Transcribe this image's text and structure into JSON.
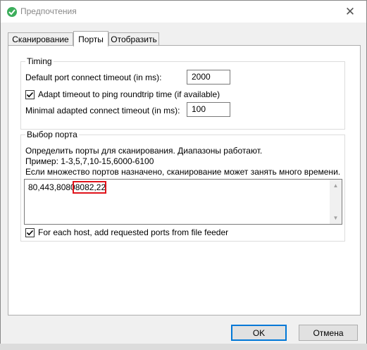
{
  "window": {
    "title": "Предпочтения",
    "close_glyph": "✕",
    "icon": "app-logo-icon"
  },
  "tabs": [
    {
      "label": "Сканирование",
      "active": false
    },
    {
      "label": "Порты",
      "active": true
    },
    {
      "label": "Отобразить",
      "active": false
    }
  ],
  "timing": {
    "title": "Timing",
    "port_timeout_label": "Default port connect timeout (in ms):",
    "port_timeout_value": "2000",
    "adapt_label": "Adapt timeout to ping roundtrip time (if available)",
    "adapt_checked": true,
    "min_timeout_label": "Minimal adapted connect timeout (in ms):",
    "min_timeout_value": "100"
  },
  "ports": {
    "title": "Выбор порта",
    "desc1": "Определить порты для сканирования. Диапазоны работают.",
    "desc2": "Пример: 1-3,5,7,10-15,6000-6100",
    "desc3": "Если множество портов назначено, сканирование может занять много времени.",
    "ports_value_plain": "80,443,8080",
    "ports_value_highlighted": "8082,22",
    "highlight_color": "#e0131b",
    "feeder_label": "For each host, add requested ports from file feeder",
    "feeder_checked": true
  },
  "buttons": {
    "ok": "OK",
    "cancel": "Отмена"
  }
}
